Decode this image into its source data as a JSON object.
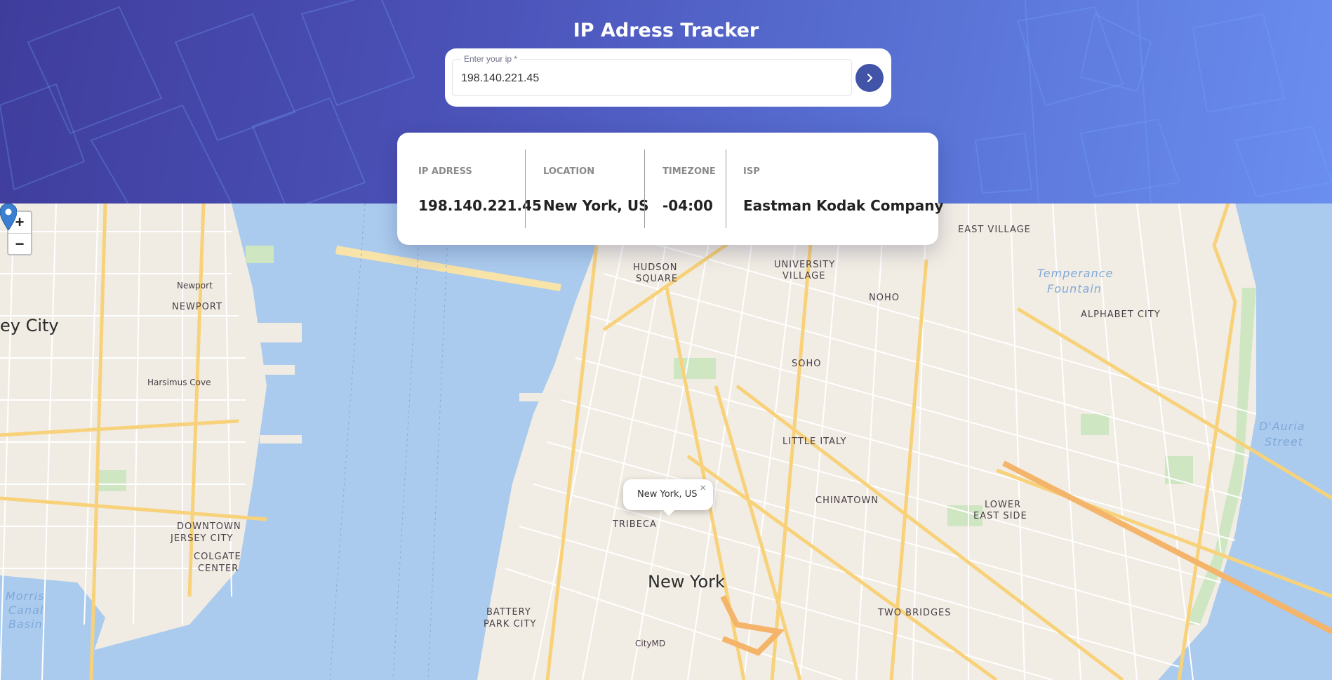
{
  "header": {
    "title": "IP Adress Tracker"
  },
  "search": {
    "label": "Enter your ip *",
    "value": "198.140.221.45",
    "submit_icon": "chevron-right-icon"
  },
  "info": {
    "ip": {
      "label": "IP ADRESS",
      "value": "198.140.221.45"
    },
    "location": {
      "label": "LOCATION",
      "value": "New York, US"
    },
    "timezone": {
      "label": "TIMEZONE",
      "value": "-04:00"
    },
    "isp": {
      "label": "ISP",
      "value": "Eastman Kodak Company"
    }
  },
  "map": {
    "zoom_in": "+",
    "zoom_out": "−",
    "popup_text": "New York, US",
    "popup_close": "×",
    "marker_icon": "map-pin-icon",
    "labels": {
      "city": "New York",
      "jersey_city": "ey City",
      "east_village": "EAST VILLAGE",
      "hudson_square_1": "HUDSON",
      "hudson_square_2": "SQUARE",
      "university_village_1": "UNIVERSITY",
      "university_village_2": "VILLAGE",
      "noho": "NOHO",
      "soho": "SOHO",
      "alphabet_city": "ALPHABET CITY",
      "little_italy": "LITTLE ITALY",
      "chinatown": "CHINATOWN",
      "lower_east_side_1": "LOWER",
      "lower_east_side_2": "EAST SIDE",
      "tribeca": "TRIBECA",
      "two_bridges": "TWO BRIDGES",
      "battery_park_1": "BATTERY",
      "battery_park_2": "PARK CITY",
      "newport": "NEWPORT",
      "downtown_jersey_1": "DOWNTOWN",
      "downtown_jersey_2": "JERSEY CITY",
      "colgate_1": "COLGATE",
      "colgate_2": "CENTER",
      "temperance_1": "Temperance",
      "temperance_2": "Fountain",
      "dauria_1": "D'Auria",
      "dauria_2": "Street",
      "morris_1": "Morris",
      "morris_2": "Canal",
      "morris_3": "Basin",
      "citymd": "CityMD",
      "harsimus": "Harsimus Cove",
      "newport_small": "Newport"
    }
  }
}
